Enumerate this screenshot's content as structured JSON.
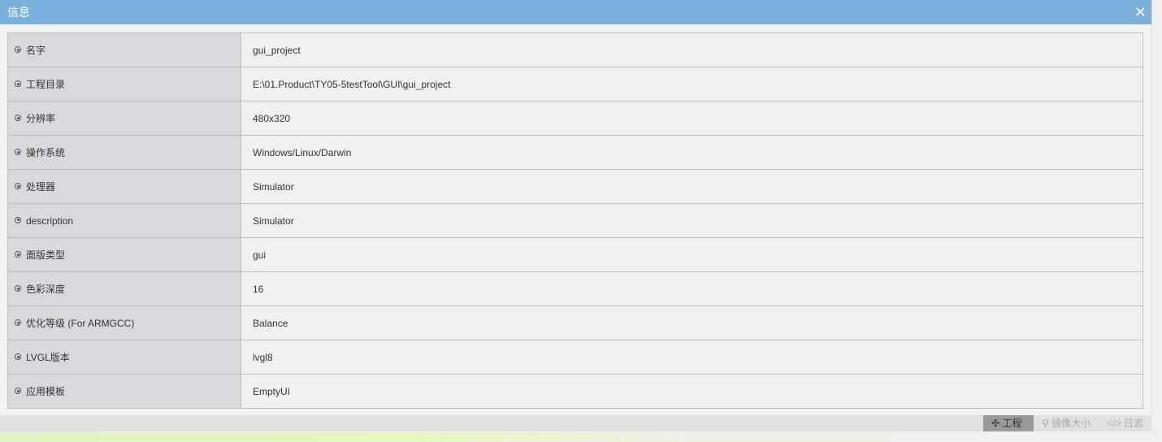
{
  "dialog": {
    "title": "信息",
    "close": "✕"
  },
  "rows": [
    {
      "label": "名字",
      "value": "gui_project"
    },
    {
      "label": "工程目录",
      "value": "E:\\01.Product\\TY05-5testTool\\GUI\\gui_project"
    },
    {
      "label": "分辨率",
      "value": "480x320"
    },
    {
      "label": "操作系统",
      "value": "Windows/Linux/Darwin"
    },
    {
      "label": "处理器",
      "value": "Simulator"
    },
    {
      "label": "description",
      "value": "Simulator"
    },
    {
      "label": "面版类型",
      "value": "gui"
    },
    {
      "label": "色彩深度",
      "value": "16"
    },
    {
      "label": "优化等级 (For ARMGCC)",
      "value": "Balance"
    },
    {
      "label": "LVGL版本",
      "value": "lvgl8"
    },
    {
      "label": "应用模板",
      "value": "EmptyUI"
    }
  ],
  "tabs": [
    {
      "icon": "✣",
      "label": "工程"
    },
    {
      "icon": "⚲",
      "label": "镜像大小"
    },
    {
      "icon": "</>",
      "label": "日志"
    }
  ]
}
